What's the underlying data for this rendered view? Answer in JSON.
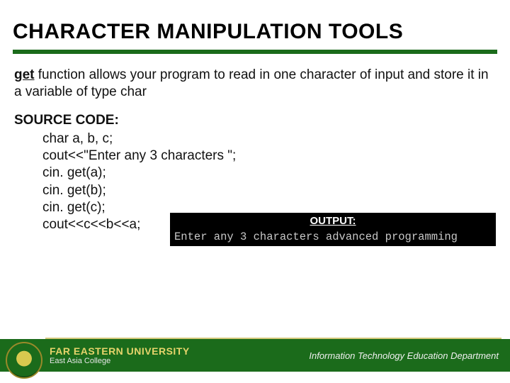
{
  "title": "CHARACTER MANIPULATION TOOLS",
  "desc": {
    "keyword": "get",
    "rest": " function allows your program to read in one character of input and store it in a variable of type char"
  },
  "code": {
    "label": "SOURCE CODE:",
    "lines": [
      "char a, b, c;",
      "cout<<\"Enter any 3 characters \";",
      "cin. get(a);",
      "cin. get(b);",
      "cin. get(c);",
      "cout<<c<<b<<a;"
    ]
  },
  "output": {
    "label": "OUTPUT:",
    "text": "Enter any 3 characters advanced programming"
  },
  "footer": {
    "university": "FAR EASTERN UNIVERSITY",
    "college": "East Asia College",
    "department": "Information Technology Education Department"
  }
}
